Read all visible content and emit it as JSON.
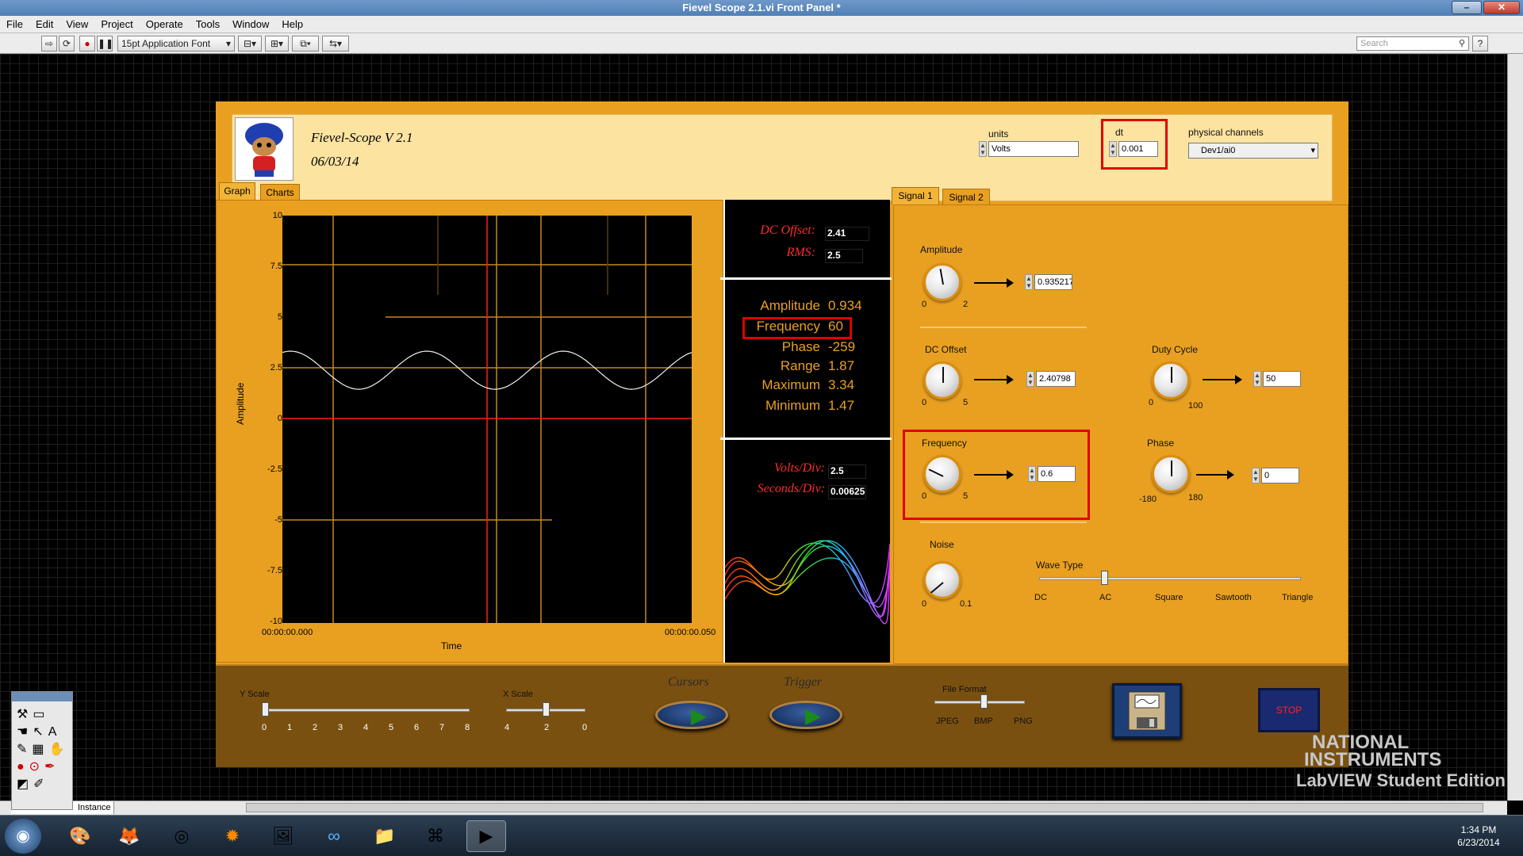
{
  "window": {
    "title": "Fievel Scope 2.1.vi Front Panel *"
  },
  "menu": [
    "File",
    "Edit",
    "View",
    "Project",
    "Operate",
    "Tools",
    "Window",
    "Help"
  ],
  "toolbar": {
    "font": "15pt Application Font",
    "search_placeholder": "Search"
  },
  "header": {
    "app_name": "Fievel-Scope V 2.1",
    "date": "06/03/14",
    "units": {
      "label": "units",
      "value": "Volts"
    },
    "dt": {
      "label": "dt",
      "value": "0.001"
    },
    "channels": {
      "label": "physical channels",
      "value": "Dev1/ai0"
    }
  },
  "graph": {
    "tabs": [
      "Graph",
      "Charts"
    ],
    "active_tab": "Graph",
    "y_ticks": [
      "10",
      "7.5",
      "5",
      "2.5",
      "0",
      "-2.5",
      "-5",
      "-7.5",
      "-10"
    ],
    "y_label": "Amplitude",
    "x_label": "Time",
    "x_start": "00:00:00.000",
    "x_end": "00:00:00.050"
  },
  "stats": {
    "dc_offset_label": "DC Offset:",
    "dc_offset": "2.41",
    "rms_label": "RMS:",
    "rms": "2.5",
    "rows": [
      {
        "label": "Amplitude",
        "value": "0.934"
      },
      {
        "label": "Frequency",
        "value": "60"
      },
      {
        "label": "Phase",
        "value": "-259"
      },
      {
        "label": "Range",
        "value": "1.87"
      },
      {
        "label": "Maximum",
        "value": "3.34"
      },
      {
        "label": "Minimum",
        "value": "1.47"
      }
    ],
    "volts_div_label": "Volts/Div:",
    "volts_div": "2.5",
    "sec_div_label": "Seconds/Div:",
    "sec_div": "0.00625"
  },
  "signal": {
    "tabs": [
      "Signal 1",
      "Signal 2"
    ],
    "active_tab": "Signal 1",
    "amplitude": {
      "label": "Amplitude",
      "min": "0",
      "max": "2",
      "value": "0.935217"
    },
    "dc_offset": {
      "label": "DC Offset",
      "min": "0",
      "max": "5",
      "value": "2.40798"
    },
    "duty_cycle": {
      "label": "Duty Cycle",
      "min": "0",
      "max": "100",
      "value": "50"
    },
    "frequency": {
      "label": "Frequency",
      "min": "0",
      "max": "5",
      "value": "0.6"
    },
    "phase": {
      "label": "Phase",
      "min": "-180",
      "max": "180",
      "value": "0"
    },
    "noise": {
      "label": "Noise",
      "min": "0",
      "max": "0.1"
    },
    "wave_type": {
      "label": "Wave Type",
      "options": [
        "DC",
        "AC",
        "Square",
        "Sawtooth",
        "Triangle"
      ],
      "selected": "AC"
    }
  },
  "bottom": {
    "y_scale": {
      "label": "Y Scale",
      "ticks": [
        "0",
        "1",
        "2",
        "3",
        "4",
        "5",
        "6",
        "7",
        "8"
      ],
      "value": 0
    },
    "x_scale": {
      "label": "X Scale",
      "ticks": [
        "4",
        "2",
        "0"
      ],
      "value": 2
    },
    "cursors_label": "Cursors",
    "trigger_label": "Trigger",
    "file_format": {
      "label": "File Format",
      "options": [
        "JPEG",
        "BMP",
        "PNG"
      ],
      "selected": "BMP"
    },
    "stop_label": "STOP"
  },
  "status": {
    "instance_text": "Instance"
  },
  "watermark": {
    "line1": "NATIONAL",
    "line2": "INSTRUMENTS",
    "line3": "LabVIEW Student Edition"
  },
  "clock": {
    "time": "1:34 PM",
    "date": "6/23/2014"
  },
  "colors": {
    "panel": "#e9a021",
    "header": "#fce3a0",
    "highlight": "#e00000"
  }
}
